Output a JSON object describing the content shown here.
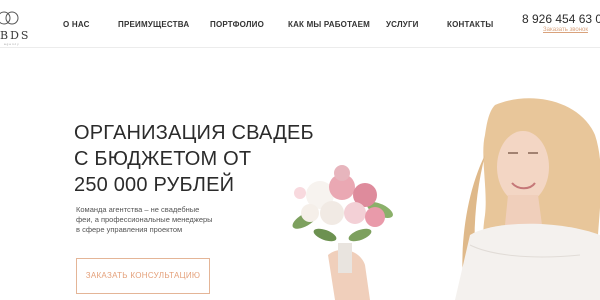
{
  "brand": {
    "logo_text": "BDS",
    "logo_subtext": "agency"
  },
  "nav": {
    "items": [
      {
        "label": "О НАС"
      },
      {
        "label": "ПРЕИМУЩЕСТВА"
      },
      {
        "label": "ПОРТФОЛИО"
      },
      {
        "label": "КАК МЫ РАБОТАЕМ"
      },
      {
        "label": "УСЛУГИ"
      },
      {
        "label": "КОНТАКТЫ"
      }
    ]
  },
  "contact": {
    "phone": "8 926 454 63 0",
    "callback_label": "Заказать звонок"
  },
  "hero": {
    "title_lines": [
      "ОРГАНИЗАЦИЯ СВАДЕБ",
      "С БЮДЖЕТОМ ОТ",
      "250 000 РУБЛЕЙ"
    ],
    "description_lines": [
      "Команда агентства – не свадебные",
      "феи, а профессиональные менеджеры",
      "в сфере управления проектом"
    ],
    "cta_label": "ЗАКАЗАТЬ КОНСУЛЬТАЦИЮ"
  },
  "colors": {
    "accent": "#e4a07a",
    "text": "#2b2b2b",
    "muted": "#555555",
    "background": "#ffffff"
  }
}
